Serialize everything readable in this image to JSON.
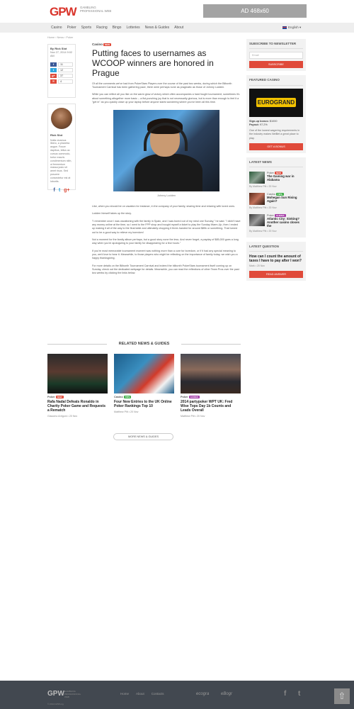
{
  "header": {
    "logo": "GPW",
    "logo_sub": "GAMBLING PROFESSIONAL WEB",
    "ad": "AD 468x60"
  },
  "nav": {
    "items": [
      "Casino",
      "Poker",
      "Sports",
      "Racing",
      "Bingo",
      "Lotteries",
      "News & Guides",
      "About"
    ],
    "language": "English"
  },
  "breadcrumb": "Home › News › Poker",
  "author": {
    "by": "By Rick Slot",
    "date": "Nov 27, 2014 9:02 AM",
    "shares": {
      "facebook": "11",
      "twitter": "12",
      "google": "37",
      "email": "4"
    }
  },
  "bio": {
    "name": "Rick Slot",
    "text": "Nulla vivamus libero, a pharetra augue. Fusce dapibus, tellus ac cursus commodo, tortor mauris condimentum nibh, ut fermentum massa justo sit amet risus. Sed posuere consectetur est at lobortis."
  },
  "article": {
    "category": "Casino",
    "badge": "NEW",
    "title": "Putting faces to usernames as WCOOP winners are honored in Prague",
    "p1": "Of all the comments we've had from PokerStars Players over the course of the past two weeks, during which the Bilbonth Tournament Carnival has been gathering pace, there were perhaps none as pragmatic as those of Johnny Lodden.",
    "p2": "While you can reflect all you like on the warm glow of victory which often accompanies a hard fought tournament, sometimes it's about something altogether more basic -- a fist-punching joy that is not necessarily glorious, but is more than enough to feel it a \"get in\" as you quickly close up your laptop before anyone starts wondering where you've been all this time.",
    "caption": "Johnny Lodden",
    "p3": "Like, when you should be on vacation for instance, in the company of your family, sharing time and relaxing with loved ones.",
    "p4": "Lodden himself takes up the story.",
    "p5": "\"I remember once I was vacationing with the family in Spain, and I was bored out of my mind one Sunday,\" he said. \"I didn't have any money online at the time, so I went to the FPP shop and bought myself a ticket to play the Sunday Warm-Up, then I ended up making it all of the way to the final table and ultimately chopping it three-handed for around $85k or something. That turned out to be a good way to relieve my boredom!",
    "p6": "Not a moment for the family album perhaps, but a good story none the less. And never forget, a payday of $85,000 goes a long way when you're apologizing to your family for disappearing for a few hours.\"",
    "p7": "If you're most memorable tournament moment was nothing more than a cure for boredom, or if it had any special meaning to you, we'd love to hear it. Meanwhile, to those players who might be reflecting on the importance of family today, we wish you a happy thanksgiving.",
    "p8": "For more details on the Bilbonth Tournament Carnival and indeed the bilbonth PokerStars tournament itself coming up on Sunday, check out the dedicated webpage for details. Meanwhile, you can read the reflections of other Team Pros over the past two weeks by clicking the links below."
  },
  "related": {
    "heading": "RELATED NEWS & GUIDES",
    "cards": [
      {
        "cat": "Poker",
        "badge": "NEW",
        "badge_color": "#e04a3a",
        "title": "Rafa Nadal Defeats Ronaldo in Charity Poker Game and Requests a Rematch",
        "meta": "Giacomo Arrigoni • 20 Nov"
      },
      {
        "cat": "Casino",
        "badge": "TIPS",
        "badge_color": "#3fae49",
        "title": "Four New Entries to the UK Online Poker Rankings Top 10",
        "meta": "Matthew Pitt • 20 Nov"
      },
      {
        "cat": "Poker",
        "badge": "GUIDES",
        "badge_color": "#a43aa6",
        "title": "2014 partypoker WPT UK: Fred Wise Tops Day 1b Counts and Leads Overall",
        "meta": "Matthew Pitt • 20 Nov"
      }
    ],
    "more": "MORE NEWS & GUIDES"
  },
  "sidebar": {
    "newsletter": {
      "heading": "SUBSCRIBE TO NEWSLETTER",
      "placeholder": "Email",
      "button": "SUBSCRIBE"
    },
    "featured": {
      "heading": "FEATURED CASINO",
      "logo": "EUROGRAND",
      "bonus_label": "Sign-up bonus:",
      "bonus": "$1000",
      "payout_label": "Payout:",
      "payout": "97.2%",
      "desc": "One of the lowest wagering requirements in the industry makes NetBet a great place to play.",
      "button": "GET A BONUS"
    },
    "latest_news": {
      "heading": "LATEST NEWS",
      "items": [
        {
          "cat": "Poker",
          "badge": "NEW",
          "badge_color": "#e04a3a",
          "title": "The Gaming war in Alabama",
          "by": "By Matthew Pitt • 20 Nov"
        },
        {
          "cat": "Casino",
          "badge": "TIPS",
          "badge_color": "#3fae49",
          "title": "Mohegan Sun Rising Again?",
          "by": "By Matthew Pitt • 20 Nov"
        },
        {
          "cat": "Poker",
          "badge": "GUIDES",
          "badge_color": "#a43aa6",
          "title": "Atlantic City: Sinking? Another casino closes the",
          "by": "By Matthew Pitt • 20 Nov"
        }
      ]
    },
    "question": {
      "heading": "LATEST QUESTION",
      "text": "How can I count the amount of taxes I have to pay after I won?",
      "meta": "Mark • 20 Nov",
      "button": "READ ANSWER"
    }
  },
  "footer": {
    "logo": "GPW",
    "logo_sub": "GAMBLING PROFESSIONAL WEB",
    "copyright": "© 2014 GPW.org",
    "links": [
      "Home",
      "About",
      "Contacts"
    ],
    "partner1": "ecogra",
    "partner2": "eBogr"
  }
}
